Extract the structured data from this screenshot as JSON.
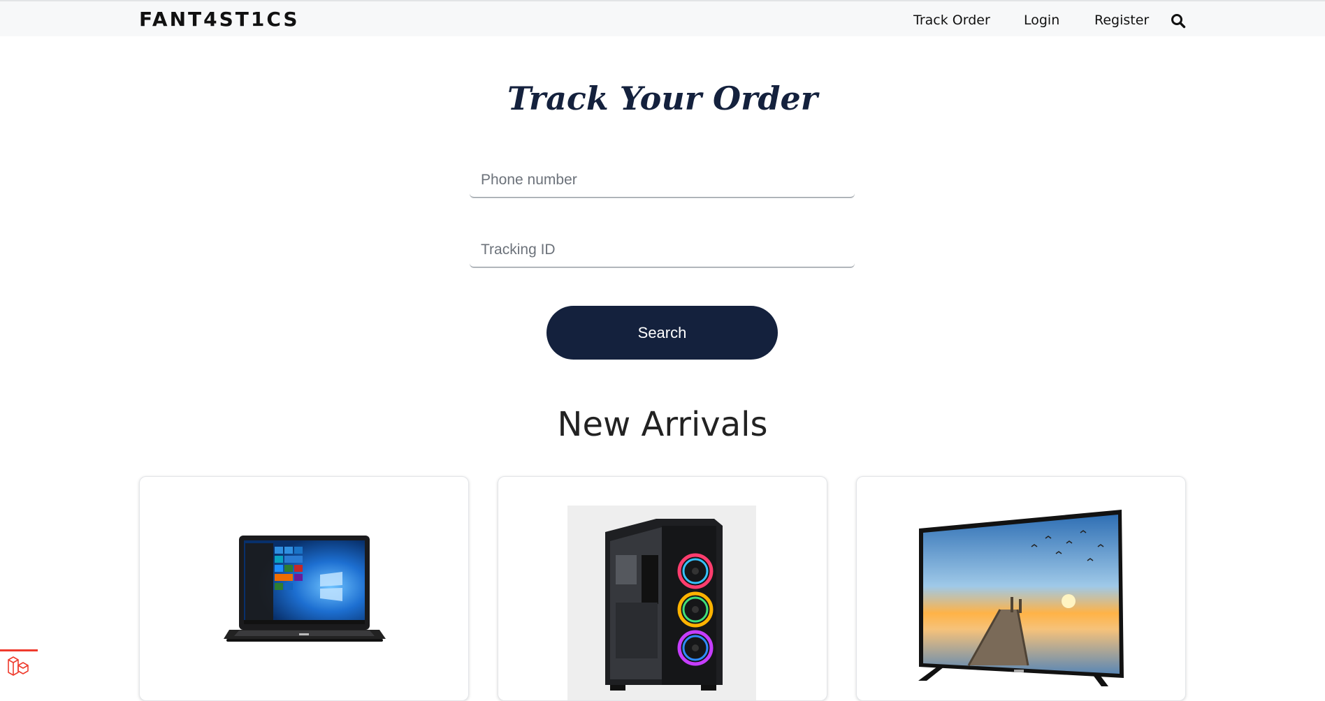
{
  "header": {
    "brand": "FANT4ST1CS",
    "nav": {
      "track_order": "Track Order",
      "login": "Login",
      "register": "Register"
    },
    "search_icon": "search-icon"
  },
  "track_form": {
    "title": "Track Your Order",
    "phone_placeholder": "Phone number",
    "phone_value": "",
    "tracking_placeholder": "Tracking ID",
    "tracking_value": "",
    "submit_label": "Search",
    "accent_color": "#14213d"
  },
  "new_arrivals": {
    "title": "New Arrivals",
    "products": [
      {
        "image": "laptop"
      },
      {
        "image": "pc-case"
      },
      {
        "image": "television"
      }
    ]
  },
  "debug_badge_icon": "laravel-logo-icon"
}
